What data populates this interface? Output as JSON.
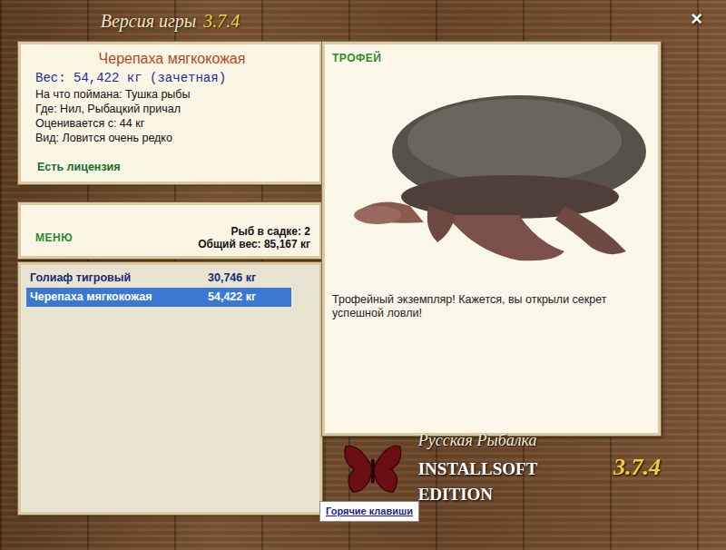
{
  "window": {
    "title": "Версия игры",
    "version": "3.7.4",
    "close": "×"
  },
  "catch": {
    "name": "Черепаха мягкокожая",
    "weight": "Вес: 54,422 кг (зачетная)",
    "details": [
      "На что поймана: Тушка рыбы",
      "Где: Нил, Рыбацкий причал",
      "Оценивается с: 44 кг",
      "Вид: Ловится очень редко"
    ],
    "license": "Есть лицензия"
  },
  "menu": {
    "label": "МЕНЮ",
    "count": "Рыб в садке: 2",
    "total": "Общий вес: 85,167 кг"
  },
  "keepnet": [
    {
      "name": "Голиаф тигровый",
      "weight": "30,746 кг",
      "selected": false
    },
    {
      "name": "Черепаха мягкокожая",
      "weight": "54,422 кг",
      "selected": true
    }
  ],
  "trophy": {
    "label": "ТРОФЕЙ",
    "message": "Трофейный экземпляр! Кажется, вы открыли секрет успешной ловли!"
  },
  "logo": {
    "subtitle": "Русская Рыбалка",
    "edition": "INSTALLSOFT EDITION",
    "version": "3.7.4"
  },
  "hotkeys": "Горячие клавиши"
}
